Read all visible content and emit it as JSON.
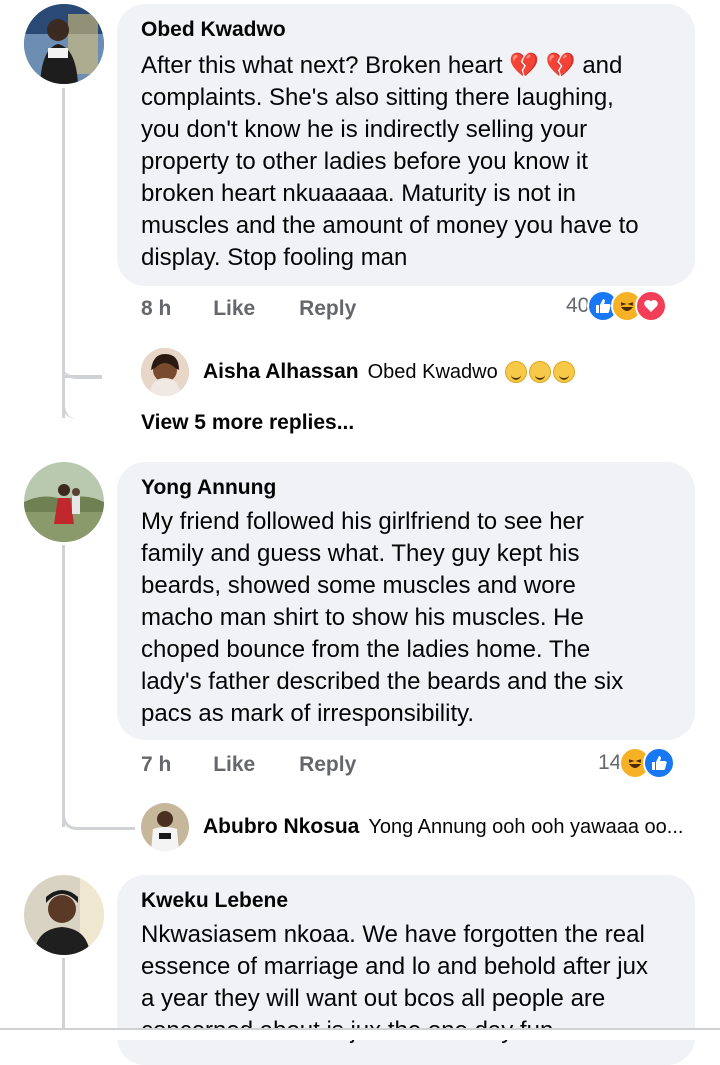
{
  "comments": [
    {
      "author": "Obed Kwadwo",
      "text": "After this what next? Broken heart 💔 💔 and complaints. She's also sitting there laughing, you don't know he is indirectly selling your property to other ladies before you know it broken heart nkuaaaaa. Maturity is not in muscles and the amount of money you have to display. Stop fooling man",
      "lines": [
        "After this what next? Broken heart 💔 💔 and",
        "complaints. She's also sitting there laughing,",
        "you don't know he is indirectly selling your",
        "property to other ladies before you know it",
        "broken heart nkuaaaaa. Maturity is not in",
        "muscles and the amount of money you have to",
        "display. Stop fooling man"
      ],
      "time": "8 h",
      "like_label": "Like",
      "reply_label": "Reply",
      "reaction_count": "40",
      "reactions": [
        "like-icon",
        "haha-icon",
        "love-icon"
      ],
      "reply": {
        "author": "Aisha Alhassan",
        "text": "Obed Kwadwo"
      },
      "view_more": "View 5 more replies..."
    },
    {
      "author": "Yong Annung",
      "lines": [
        "My friend followed his girlfriend to see her",
        "family and guess what. They guy kept his",
        "beards, showed some muscles and wore",
        "macho man shirt to show his muscles. He",
        "choped bounce from the ladies home. The",
        "lady's  father described the beards and the six",
        "pacs as mark of irresponsibility."
      ],
      "time": "7 h",
      "like_label": "Like",
      "reply_label": "Reply",
      "reaction_count": "14",
      "reactions": [
        "haha-icon",
        "like-icon"
      ],
      "reply": {
        "author": "Abubro Nkosua",
        "text": "Yong Annung ooh ooh yawaaa oo..."
      }
    },
    {
      "author": "Kweku Lebene",
      "lines": [
        "Nkwasiasem nkoaa. We have forgotten the real",
        "essence of marriage and lo and behold after jux",
        "a year they will want out bcos all people are",
        "concerned about is jux the one day fun"
      ]
    }
  ],
  "colors": {
    "bubble": "#f0f2f5",
    "meta_text": "#65676b",
    "like_blue": "#1877f2",
    "love_red": "#f33e58",
    "haha_yellow": "#f7b125"
  }
}
